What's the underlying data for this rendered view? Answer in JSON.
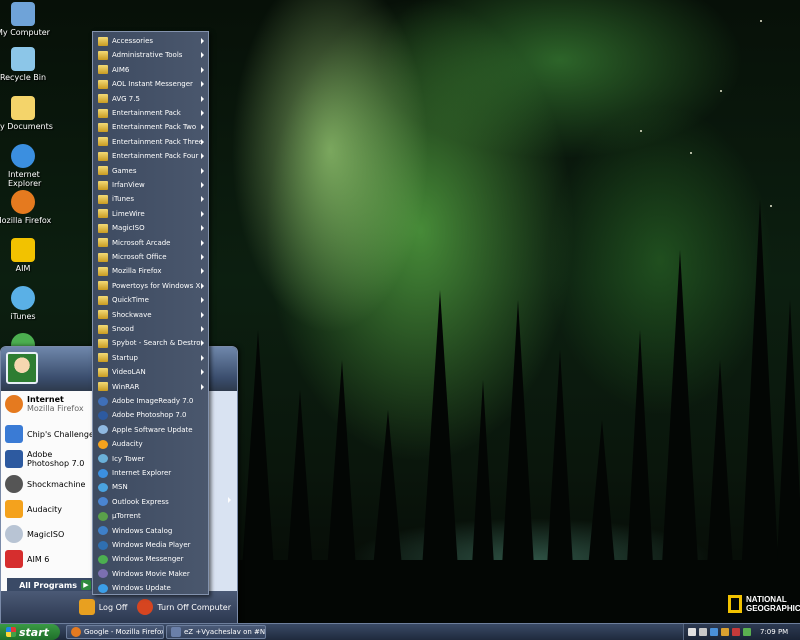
{
  "desktop": {
    "icons": [
      {
        "label": "My Computer",
        "icon": "computer-icon",
        "color": "#6fa3d8"
      },
      {
        "label": "Recycle Bin",
        "icon": "recycle-bin-icon",
        "color": "#8cc6e8"
      },
      {
        "label": "My Documents",
        "icon": "documents-icon",
        "color": "#f4d46a"
      },
      {
        "label": "Internet Explorer",
        "icon": "internet-explorer-icon",
        "color": "#3b8fe0"
      },
      {
        "label": "Mozilla Firefox",
        "icon": "firefox-icon",
        "color": "#e57a1f"
      },
      {
        "label": "AIM",
        "icon": "aim-icon",
        "color": "#f2c200"
      },
      {
        "label": "iTunes",
        "icon": "itunes-icon",
        "color": "#5ab0e6"
      }
    ],
    "wallpaper_brand": "NATIONAL GEOGRAPHIC"
  },
  "start_menu": {
    "pinned": [
      {
        "label": "Internet",
        "sublabel": "Mozilla Firefox",
        "icon": "firefox-icon",
        "color": "#e57a1f"
      },
      {
        "label": "Chip's Challenge",
        "icon": "chips-challenge-icon",
        "color": "#3a7bd5"
      },
      {
        "label": "Adobe Photoshop 7.0",
        "icon": "photoshop-icon",
        "color": "#2d5aa0"
      },
      {
        "label": "Shockmachine",
        "icon": "shockmachine-icon",
        "color": "#555555"
      },
      {
        "label": "Audacity",
        "icon": "audacity-icon",
        "color": "#f4a21d"
      },
      {
        "label": "MagicISO",
        "icon": "magiciso-icon",
        "color": "#b8c4d4"
      },
      {
        "label": "AIM 6",
        "icon": "aim-icon",
        "color": "#d62e2e"
      }
    ],
    "all_programs": "All Programs",
    "log_off": "Log Off",
    "turn_off": "Turn Off Computer"
  },
  "programs": [
    {
      "label": "Accessories",
      "folder": true,
      "sub": true
    },
    {
      "label": "Administrative Tools",
      "folder": true,
      "sub": true
    },
    {
      "label": "AIM6",
      "folder": true,
      "sub": true
    },
    {
      "label": "AOL Instant Messenger",
      "folder": true,
      "sub": true
    },
    {
      "label": "AVG 7.5",
      "folder": true,
      "sub": true
    },
    {
      "label": "Entertainment Pack",
      "folder": true,
      "sub": true
    },
    {
      "label": "Entertainment Pack Two",
      "folder": true,
      "sub": true
    },
    {
      "label": "Entertainment Pack Three",
      "folder": true,
      "sub": true
    },
    {
      "label": "Entertainment Pack Four",
      "folder": true,
      "sub": true
    },
    {
      "label": "Games",
      "folder": true,
      "sub": true
    },
    {
      "label": "IrfanView",
      "folder": true,
      "sub": true
    },
    {
      "label": "iTunes",
      "folder": true,
      "sub": true
    },
    {
      "label": "LimeWire",
      "folder": true,
      "sub": true
    },
    {
      "label": "MagicISO",
      "folder": true,
      "sub": true
    },
    {
      "label": "Microsoft Arcade",
      "folder": true,
      "sub": true
    },
    {
      "label": "Microsoft Office",
      "folder": true,
      "sub": true
    },
    {
      "label": "Mozilla Firefox",
      "folder": true,
      "sub": true
    },
    {
      "label": "Powertoys for Windows XP",
      "folder": true,
      "sub": true
    },
    {
      "label": "QuickTime",
      "folder": true,
      "sub": true
    },
    {
      "label": "Shockwave",
      "folder": true,
      "sub": true
    },
    {
      "label": "Snood",
      "folder": true,
      "sub": true
    },
    {
      "label": "Spybot - Search & Destroy",
      "folder": true,
      "sub": true
    },
    {
      "label": "Startup",
      "folder": true,
      "sub": true
    },
    {
      "label": "VideoLAN",
      "folder": true,
      "sub": true
    },
    {
      "label": "WinRAR",
      "folder": true,
      "sub": true
    },
    {
      "label": "Adobe ImageReady 7.0",
      "folder": false,
      "sub": false,
      "color": "#3f6fb8"
    },
    {
      "label": "Adobe Photoshop 7.0",
      "folder": false,
      "sub": false,
      "color": "#2d5aa0"
    },
    {
      "label": "Apple Software Update",
      "folder": false,
      "sub": false,
      "color": "#8fb8e0"
    },
    {
      "label": "Audacity",
      "folder": false,
      "sub": false,
      "color": "#f4a21d"
    },
    {
      "label": "Icy Tower",
      "folder": false,
      "sub": false,
      "color": "#6ab0d8"
    },
    {
      "label": "Internet Explorer",
      "folder": false,
      "sub": false,
      "color": "#3b8fe0"
    },
    {
      "label": "MSN",
      "folder": false,
      "sub": false,
      "color": "#4aa3e0"
    },
    {
      "label": "Outlook Express",
      "folder": false,
      "sub": true,
      "color": "#4a84d0"
    },
    {
      "label": "µTorrent",
      "folder": false,
      "sub": false,
      "color": "#5aa04a"
    },
    {
      "label": "Windows Catalog",
      "folder": false,
      "sub": false,
      "color": "#3e7fc8"
    },
    {
      "label": "Windows Media Player",
      "folder": false,
      "sub": false,
      "color": "#2f6fb0"
    },
    {
      "label": "Windows Messenger",
      "folder": false,
      "sub": false,
      "color": "#4caf50"
    },
    {
      "label": "Windows Movie Maker",
      "folder": false,
      "sub": false,
      "color": "#7b6fb0"
    },
    {
      "label": "Windows Update",
      "folder": false,
      "sub": false,
      "color": "#3b9ee8"
    }
  ],
  "taskbar": {
    "start": "start",
    "tasks": [
      {
        "label": "Google - Mozilla Firefox",
        "icon": "firefox-icon",
        "color": "#e57a1f"
      },
      {
        "label": "eZ +Vyacheslav on #N (...",
        "icon": "irc-icon",
        "color": "#6a7fa8"
      }
    ],
    "clock": "7:09 PM"
  }
}
